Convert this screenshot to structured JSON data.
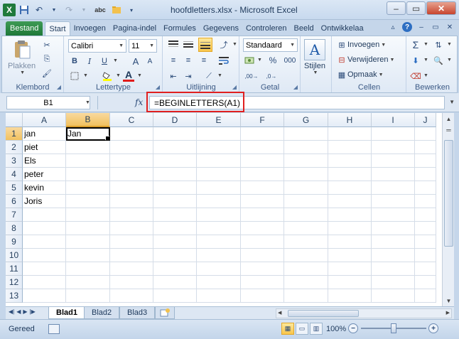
{
  "window": {
    "title": "hoofdletters.xlsx - Microsoft Excel",
    "app_icon": "X"
  },
  "qat": {
    "spell_label": "abc"
  },
  "ribbon_tabs": [
    "Bestand",
    "Start",
    "Invoegen",
    "Pagina-indel",
    "Formules",
    "Gegevens",
    "Controleren",
    "Beeld",
    "Ontwikkelaa"
  ],
  "ribbon": {
    "clipboard": {
      "paste": "Plakken",
      "label": "Klembord"
    },
    "font": {
      "name": "Calibri",
      "size": "11",
      "label": "Lettertype",
      "bold": "B",
      "italic": "I",
      "underline": "U",
      "grow": "A",
      "shrink": "A",
      "color": "A"
    },
    "alignment": {
      "label": "Uitlijning"
    },
    "number": {
      "format": "Standaard",
      "percent": "%",
      "thousands": "000",
      "label": "Getal"
    },
    "styles": {
      "label": "Stijlen",
      "icon_letter": "A"
    },
    "cells": {
      "insert": "Invoegen",
      "delete": "Verwijderen",
      "format": "Opmaak",
      "label": "Cellen"
    },
    "editing": {
      "label": "Bewerken"
    }
  },
  "formula_bar": {
    "name_box": "B1",
    "fx": "fx",
    "formula": "=BEGINLETTERS(A1)"
  },
  "columns": [
    "A",
    "B",
    "C",
    "D",
    "E",
    "F",
    "G",
    "H",
    "I",
    "J"
  ],
  "rows": [
    "1",
    "2",
    "3",
    "4",
    "5",
    "6",
    "7",
    "8",
    "9",
    "10",
    "11",
    "12",
    "13"
  ],
  "cells": {
    "A1": "jan",
    "B1": "Jan",
    "A2": "piet",
    "A3": "Els",
    "A4": "peter",
    "A5": "kevin",
    "A6": "Joris"
  },
  "active_cell": "B1",
  "sheets": [
    "Blad1",
    "Blad2",
    "Blad3"
  ],
  "active_sheet": "Blad1",
  "status": {
    "ready": "Gereed",
    "zoom": "100%",
    "zoom_fraction": 0.5
  }
}
